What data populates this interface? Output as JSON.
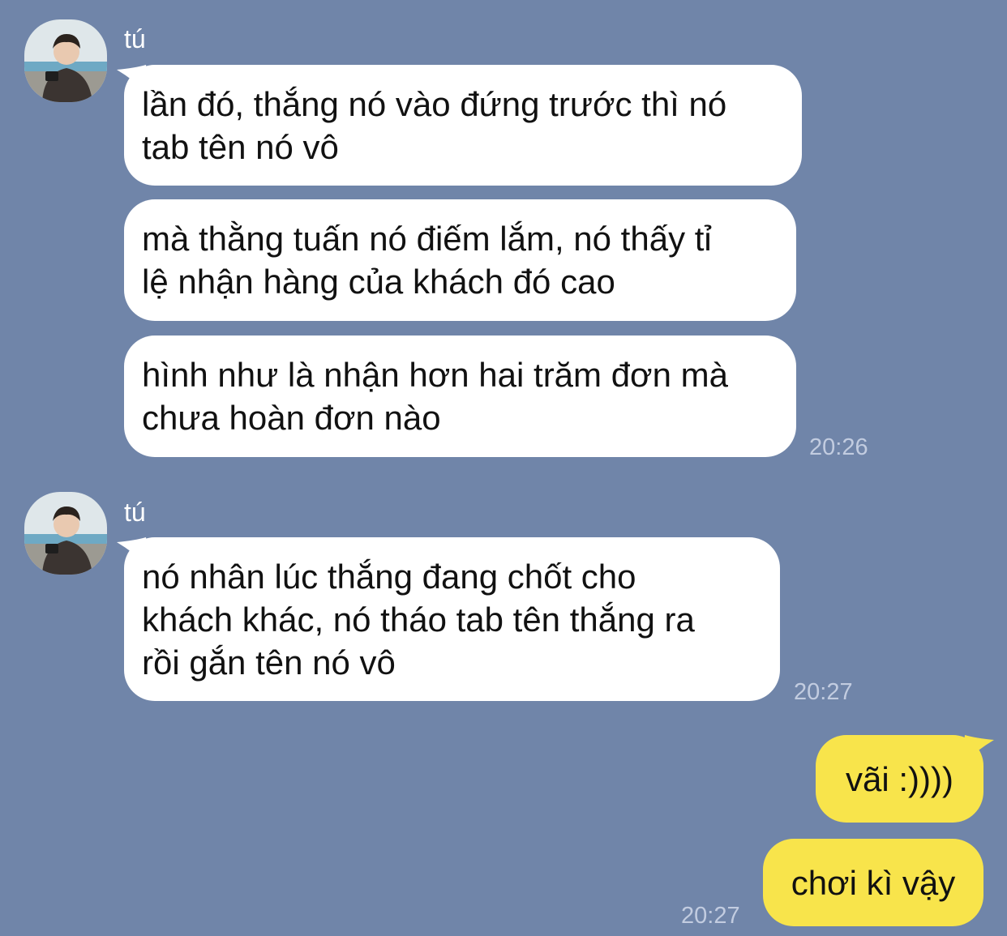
{
  "chat": {
    "groups": [
      {
        "sender": "tú",
        "messages": [
          "lần đó, thắng nó vào đứng trước thì nó\ntab tên nó vô",
          "mà thằng tuấn nó điếm lắm, nó thấy tỉ\nlệ nhận hàng của khách đó cao",
          "hình như là nhận hơn hai trăm đơn mà\nchưa hoàn đơn nào"
        ],
        "time": "20:26"
      },
      {
        "sender": "tú",
        "messages": [
          "nó nhân lúc thắng đang chốt cho\nkhách khác, nó tháo tab tên thắng ra\nrồi gắn tên nó vô"
        ],
        "time": "20:27"
      }
    ],
    "outgoing": {
      "messages": [
        "vãi :))))",
        "chơi kì vậy"
      ],
      "time": "20:27"
    }
  },
  "colors": {
    "background": "#7085a9",
    "incoming_bubble": "#ffffff",
    "outgoing_bubble": "#f8e44b",
    "timestamp": "#c2cce0"
  },
  "icons": {
    "avatar": "profile-photo-avatar"
  }
}
